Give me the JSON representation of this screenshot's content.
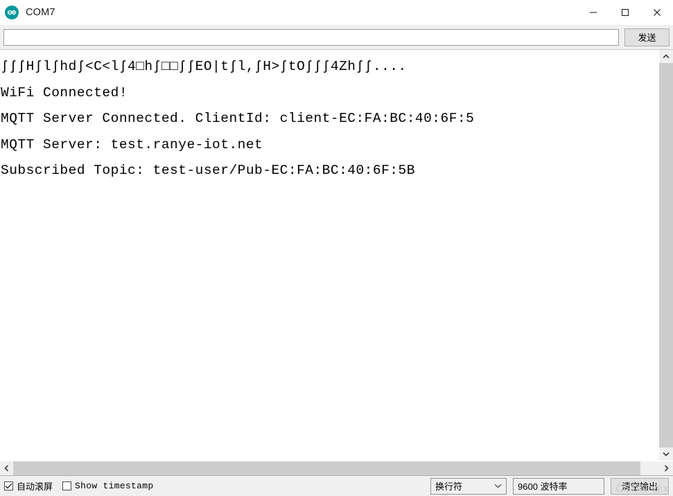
{
  "window": {
    "title": "COM7",
    "icon": "arduino-logo-icon",
    "accent_color": "#00979c",
    "controls": {
      "minimize": "minimize-icon",
      "maximize": "maximize-icon",
      "close": "close-icon"
    }
  },
  "send_bar": {
    "input_value": "",
    "input_placeholder": "",
    "send_label": "发送"
  },
  "terminal": {
    "lines": [
      "ʃʃʃHʃlʃhdʃ<C<lʃ4□hʃ□□ʃʃEO|tʃl,ʃH>ʃtOʃʃʃ4Zhʃʃ....",
      "WiFi Connected!",
      "",
      "MQTT Server Connected. ClientId: client-EC:FA:BC:40:6F:5",
      "MQTT Server: test.ranye-iot.net",
      "Subscribed Topic: test-user/Pub-EC:FA:BC:40:6F:5B"
    ]
  },
  "scrollbars": {
    "vertical_up": "chevron-up-icon",
    "vertical_down": "chevron-down-icon",
    "horizontal_left": "chevron-left-icon",
    "horizontal_right": "chevron-right-icon"
  },
  "status_bar": {
    "autoscroll": {
      "label": "自动滚屏",
      "checked": true
    },
    "timestamp": {
      "label": "Show timestamp",
      "checked": false
    },
    "line_ending": {
      "value": "换行符"
    },
    "baud_rate": {
      "value": "9600 波特率"
    },
    "clear_button": "清空输出",
    "watermark": "CSDN @x"
  }
}
